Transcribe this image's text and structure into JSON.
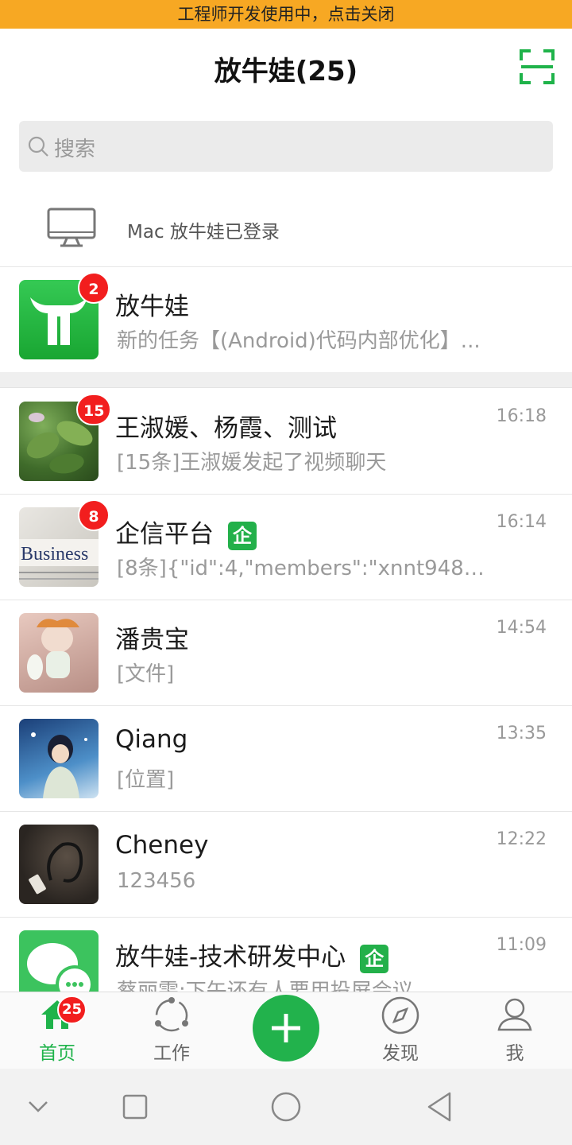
{
  "dev_banner": "工程师开发使用中，点击关闭",
  "header": {
    "title": "放牛娃(25)",
    "scan_icon": "scan-icon"
  },
  "search": {
    "placeholder": "搜索"
  },
  "login_notice": "Mac 放牛娃已登录",
  "app_item": {
    "name": "放牛娃",
    "preview": "新的任务【(Android)代码内部优化】...",
    "badge": "2"
  },
  "chats": [
    {
      "name": "王淑媛、杨霞、测试",
      "preview": "[15条]王淑媛发起了视频聊天",
      "time": "16:18",
      "badge": "15",
      "enterprise": false
    },
    {
      "name": "企信平台",
      "preview": "[8条]{\"id\":4,\"members\":\"xnnt9481...",
      "time": "16:14",
      "badge": "8",
      "enterprise": true
    },
    {
      "name": "潘贵宝",
      "preview": "[文件]",
      "time": "14:54",
      "badge": "",
      "enterprise": false
    },
    {
      "name": "Qiang",
      "preview": "[位置]",
      "time": "13:35",
      "badge": "",
      "enterprise": false
    },
    {
      "name": "Cheney",
      "preview": "123456",
      "time": "12:22",
      "badge": "",
      "enterprise": false
    },
    {
      "name": "放牛娃-技术研发中心",
      "preview": "蔡丽雯:下午还有人要用投屏会议",
      "time": "11:09",
      "badge": "",
      "enterprise": true
    }
  ],
  "enterprise_tag": "企",
  "tabbar": {
    "home": {
      "label": "首页",
      "badge": "25"
    },
    "work": {
      "label": "工作"
    },
    "discover": {
      "label": "发现"
    },
    "me": {
      "label": "我"
    }
  },
  "colors": {
    "accent": "#1fb34a",
    "badge": "#f21e1e",
    "banner": "#f7a823"
  }
}
